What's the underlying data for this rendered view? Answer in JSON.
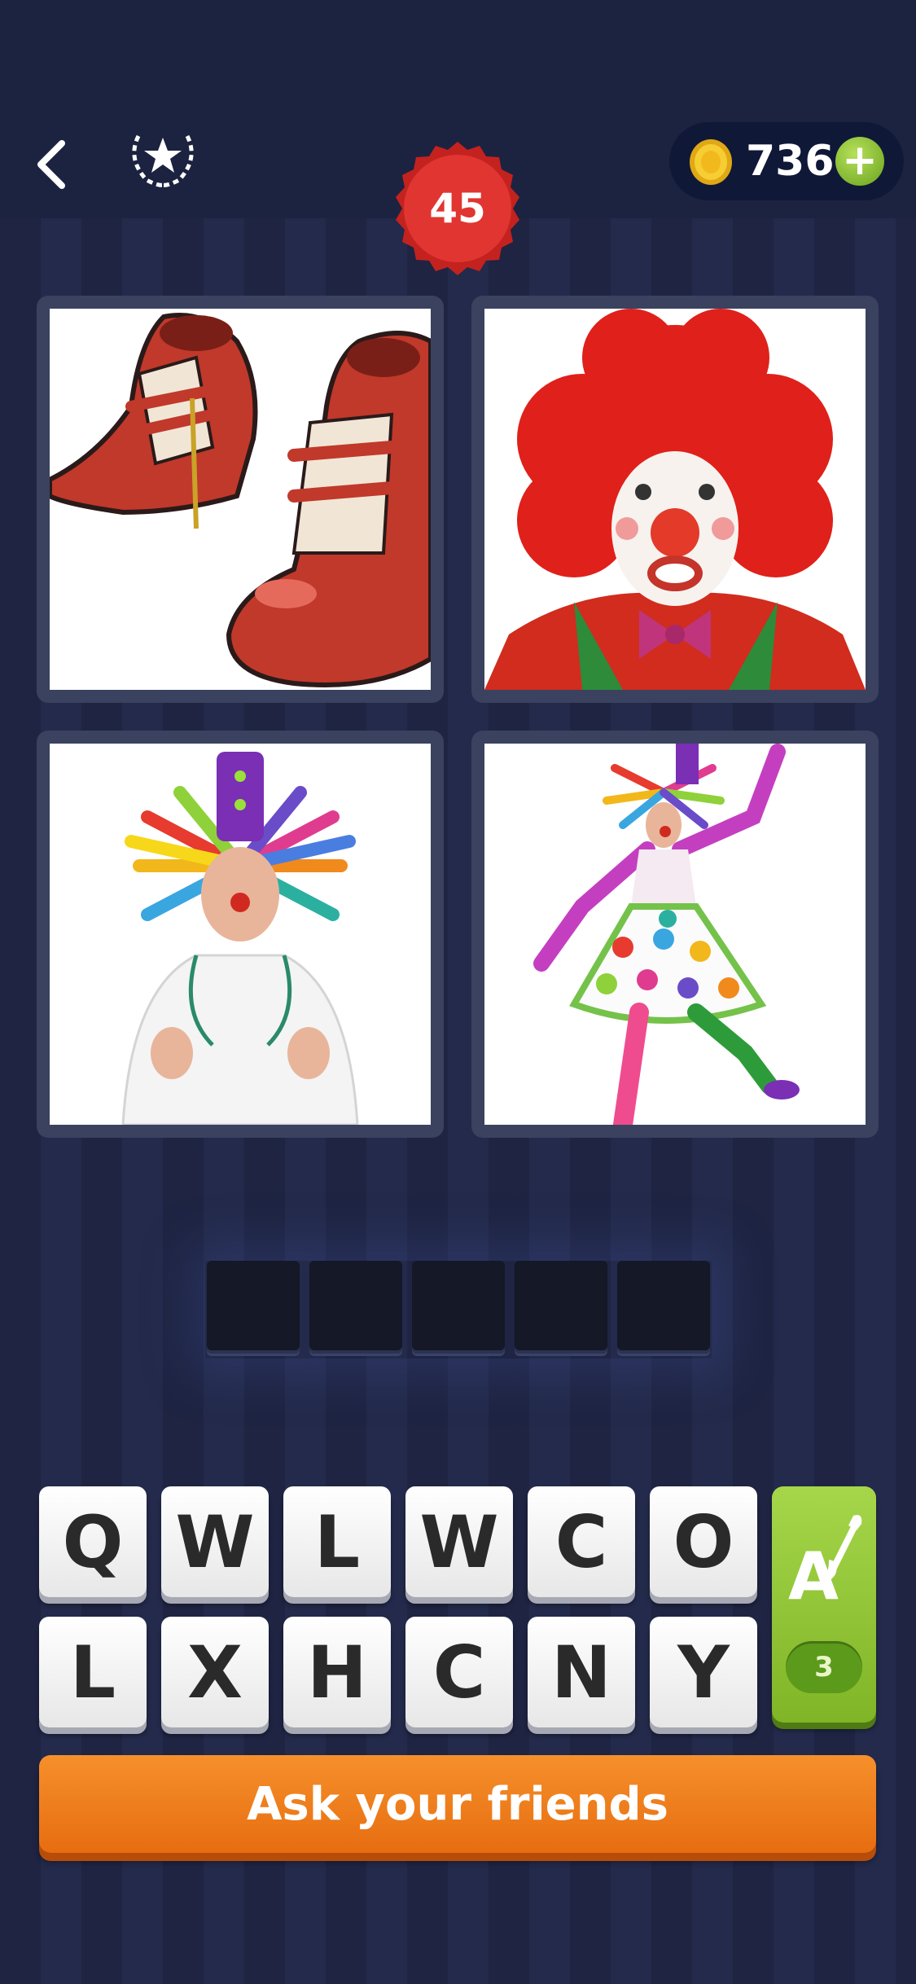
{
  "header": {
    "level": "45",
    "coins": "736",
    "back_icon": "chevron-left-icon",
    "achievements_icon": "laurel-star-icon",
    "add_coins_label": "+"
  },
  "puzzle": {
    "pictures": [
      {
        "icon": "clown-shoes-illustration"
      },
      {
        "icon": "clown-red-wig-photo"
      },
      {
        "icon": "clown-doctor-photo"
      },
      {
        "icon": "clown-dress-jumping-photo"
      }
    ],
    "answer_slots": [
      "",
      "",
      "",
      "",
      ""
    ]
  },
  "keyboard": {
    "row1": [
      "Q",
      "W",
      "L",
      "W",
      "C",
      "O"
    ],
    "row2": [
      "L",
      "X",
      "H",
      "C",
      "N",
      "Y"
    ],
    "hint": {
      "icon": "letter-brush-icon",
      "count": "3"
    }
  },
  "actions": {
    "ask_label": "Ask your friends"
  },
  "colors": {
    "background": "#1e2442",
    "level_badge": "#e0302e",
    "hint_button": "#8cc63e",
    "ask_button": "#f08020"
  }
}
